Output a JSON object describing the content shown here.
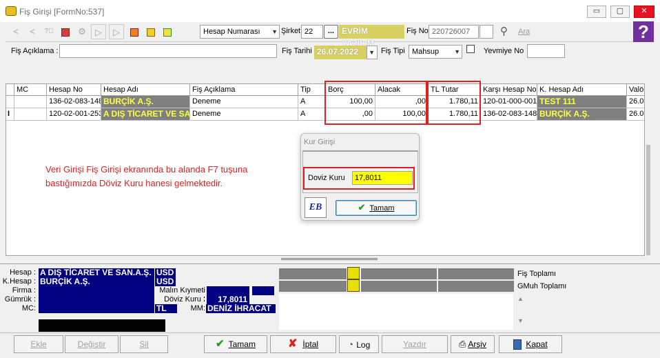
{
  "window": {
    "title": "Fiş Girişi [FormNo:537]",
    "minimize": "▭",
    "maximize": "▢",
    "close": "✕"
  },
  "toolbar": {
    "hesap_select": "Hesap Numarası",
    "sirket_label": "Şirket",
    "sirket_value": "22",
    "sirket_browse": "...",
    "company_name": "EVRİM YAZILIM",
    "fis_no_label": "Fiş No",
    "fis_no_value": "220726007",
    "search_label": "Ara",
    "help": "?"
  },
  "header": {
    "aciklama_label": "Fiş Açıklama :",
    "aciklama_value": "",
    "tarih_label": "Fiş Tarihi",
    "tarih_value": "26.07.2022",
    "tipi_label": "Fiş Tipi",
    "tipi_value": "Mahsup",
    "yevmiye_label": "Yevmiye No",
    "yevmiye_value": ""
  },
  "grid": {
    "columns": [
      "MC",
      "Hesap No",
      "Hesap Adı",
      "Fiş Açıklama",
      "Tip",
      "Borç",
      "Alacak",
      "TL Tutar",
      "Karşı Hesap No",
      "K. Hesap Adı",
      "Valö"
    ],
    "rows": [
      {
        "indicator": "",
        "mc": "",
        "hesap_no": "136-02-083-148",
        "hesap_adi": "BURÇİK A.Ş.",
        "aciklama": "Deneme",
        "tip": "A",
        "borc": "100,00",
        "alacak": ",00",
        "tl_tutar": "1.780,11",
        "karsi_no": "120-01-000-001",
        "k_hesap_adi": "TEST 111",
        "valor": "26.0"
      },
      {
        "indicator": "I",
        "mc": "",
        "hesap_no": "120-02-001-253",
        "hesap_adi": "A DIŞ TİCARET VE SAN",
        "aciklama": "Deneme",
        "tip": "A",
        "borc": ",00",
        "alacak": "100,00",
        "tl_tutar": "1.780,11",
        "karsi_no": "136-02-083-148",
        "k_hesap_adi": "BURÇİK A.Ş.",
        "valor": "26.0"
      }
    ]
  },
  "note": "Veri Girişi Fiş Girişi ekranında bu alanda F7 tuşuna bastığımızda Döviz Kuru hanesi gelmektedir.",
  "dialog": {
    "title": "Kur Girişi",
    "doviz_label": "Doviz Kuru",
    "doviz_value": "17,8011",
    "ok_label": "Tamam",
    "logo": "EB"
  },
  "info": {
    "hesap_label": "Hesap :",
    "hesap_value": "A DIŞ TİCARET VE SAN.A.Ş.",
    "hesap_cur": "USD",
    "khesap_label": "K.Hesap :",
    "khesap_value": "BURÇİK A.Ş.",
    "khesap_cur": "USD",
    "firma_label": "Firma :",
    "malin_label": "Malın Kıymeti :",
    "gumruk_label": "Gümrük :",
    "doviz_label": "Döviz Kuru :",
    "doviz_value": "17,8011",
    "mc_label": "MC:",
    "mc_cur": "TL",
    "mm_label": "MM:",
    "mm_value": "DENİZ İHRACAT",
    "fis_toplami": "Fiş Toplamı",
    "gmuh_toplami": "GMuh Toplamı"
  },
  "footer": {
    "ekle": "Ekle",
    "degistir": "Değiştir",
    "sil": "Sil",
    "tamam": "Tamam",
    "iptal": "İptal",
    "log": "Log",
    "yazdir": "Yazdır",
    "arsiv": "Arşiv",
    "kapat": "Kapat"
  }
}
